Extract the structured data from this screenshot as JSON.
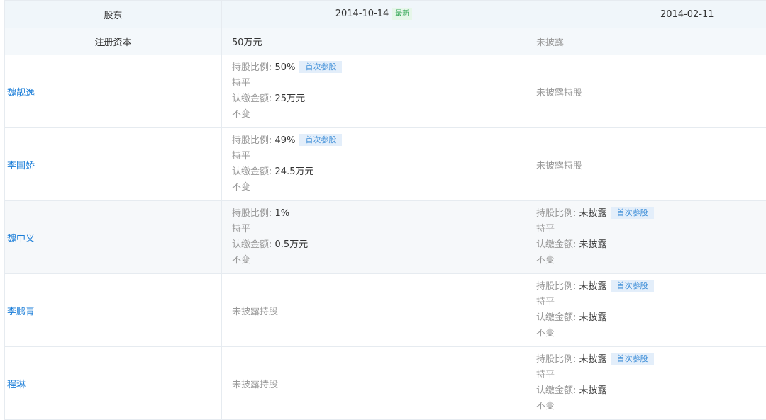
{
  "header": {
    "col_label": "股东",
    "period1_date": "2014-10-14",
    "period1_badge": "最新",
    "period2_date": "2014-02-11"
  },
  "registered_capital": {
    "label": "注册资本",
    "period1": "50万元",
    "period2": "未披露"
  },
  "labels": {
    "ratio": "持股比例:",
    "subscribed": "认缴金额:",
    "first_badge": "首次参股",
    "undisclosed_holding": "未披露持股"
  },
  "shareholders": [
    {
      "name": "魏靓逸",
      "p1": {
        "ratio": "50%",
        "first": true,
        "ratio_change": "持平",
        "amount": "25万元",
        "amount_change": "不变"
      },
      "p2": {
        "undisclosed": true
      }
    },
    {
      "name": "李国娇",
      "p1": {
        "ratio": "49%",
        "first": true,
        "ratio_change": "持平",
        "amount": "24.5万元",
        "amount_change": "不变"
      },
      "p2": {
        "undisclosed": true
      }
    },
    {
      "name": "魏中义",
      "p1": {
        "ratio": "1%",
        "first": false,
        "ratio_change": "持平",
        "amount": "0.5万元",
        "amount_change": "不变"
      },
      "p2": {
        "ratio": "未披露",
        "first": true,
        "ratio_change": "持平",
        "amount": "未披露",
        "amount_change": "不变"
      }
    },
    {
      "name": "李鹏青",
      "p1": {
        "undisclosed": true
      },
      "p2": {
        "ratio": "未披露",
        "first": true,
        "ratio_change": "持平",
        "amount": "未披露",
        "amount_change": "不变"
      }
    },
    {
      "name": "程琳",
      "p1": {
        "undisclosed": true
      },
      "p2": {
        "ratio": "未披露",
        "first": true,
        "ratio_change": "持平",
        "amount": "未披露",
        "amount_change": "不变"
      }
    }
  ]
}
